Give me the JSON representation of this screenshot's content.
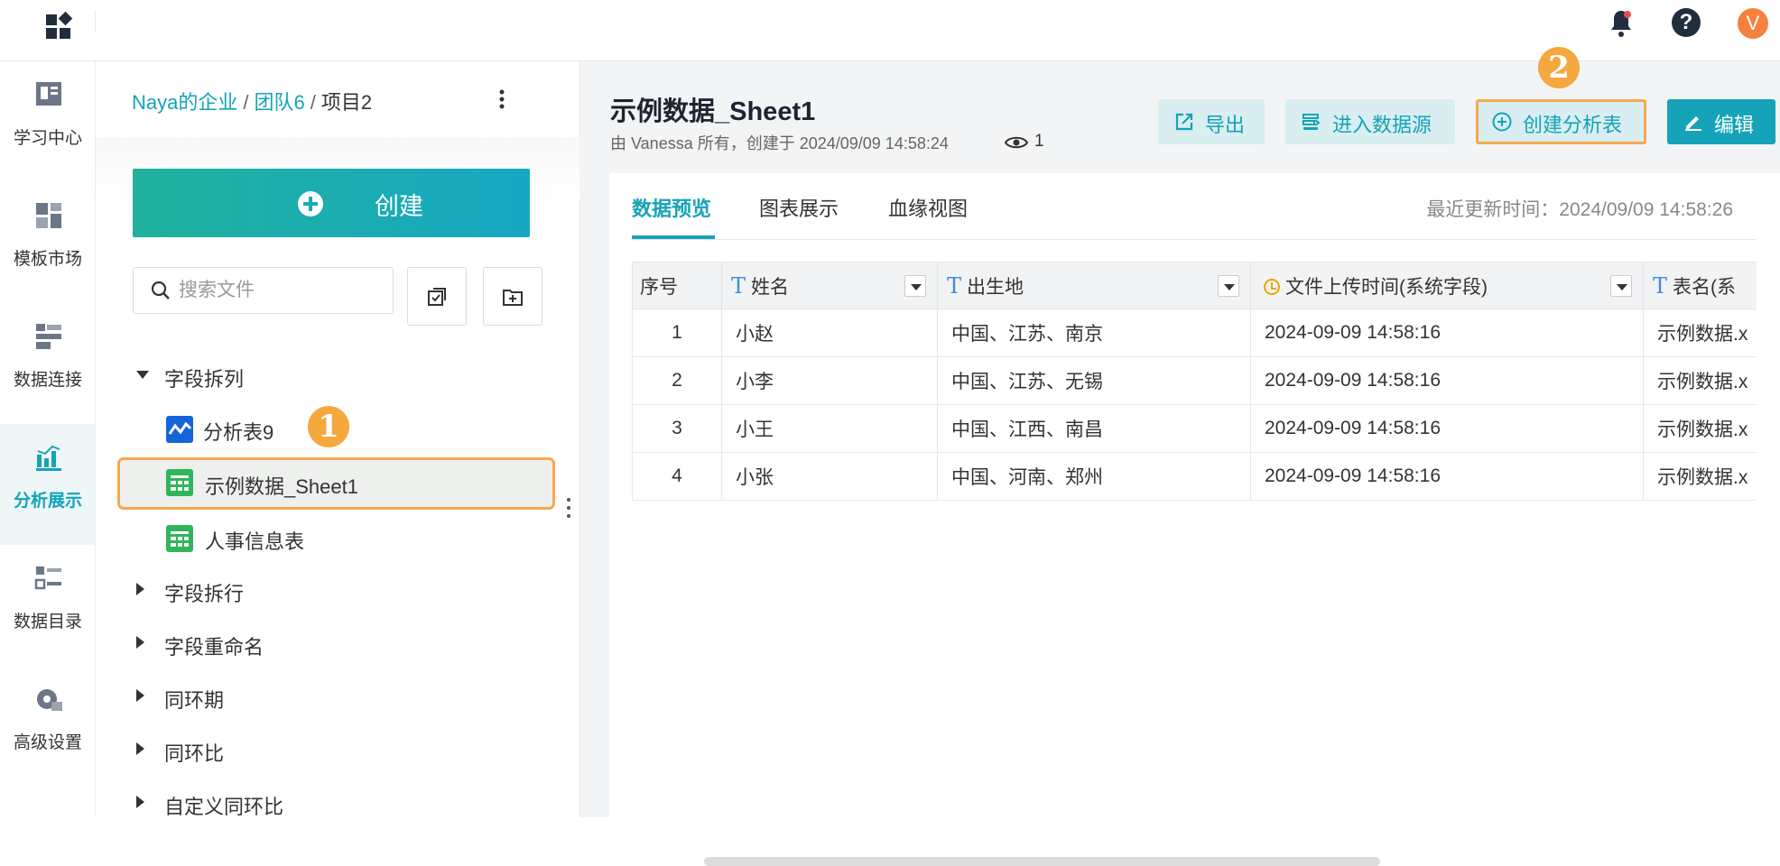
{
  "nav": {
    "items": [
      {
        "label": "学习中心",
        "icon": "learning-center-icon"
      },
      {
        "label": "模板市场",
        "icon": "template-market-icon"
      },
      {
        "label": "数据连接",
        "icon": "data-connection-icon"
      },
      {
        "label": "分析展示",
        "icon": "analysis-display-icon",
        "active": true
      },
      {
        "label": "数据目录",
        "icon": "data-catalog-icon"
      },
      {
        "label": "高级设置",
        "icon": "advanced-settings-icon"
      }
    ]
  },
  "header": {
    "avatar_letter": "V"
  },
  "breadcrumb": {
    "org": "Naya的企业",
    "team": "团队6",
    "project": "项目2",
    "sep": "/"
  },
  "sidebar": {
    "create_label": "创建",
    "search_placeholder": "搜索文件",
    "tree": [
      {
        "label": "字段拆列",
        "expanded": true
      },
      {
        "label": "分析表9",
        "type": "analysis"
      },
      {
        "label": "示例数据_Sheet1",
        "type": "table",
        "selected": true
      },
      {
        "label": "人事信息表",
        "type": "table"
      },
      {
        "label": "字段拆行"
      },
      {
        "label": "字段重命名"
      },
      {
        "label": "同环期"
      },
      {
        "label": "同环比"
      },
      {
        "label": "自定义同环比"
      }
    ],
    "step_badge": "1"
  },
  "dataset": {
    "title": "示例数据_Sheet1",
    "subtitle": "由 Vanessa 所有，创建于 2024/09/09 14:58:24",
    "views": "1"
  },
  "toolbar": {
    "export_label": "导出",
    "datasource_label": "进入数据源",
    "create_analysis_label": "创建分析表",
    "edit_label": "编辑",
    "step_badge": "2"
  },
  "tabs": [
    {
      "label": "数据预览",
      "active": true
    },
    {
      "label": "图表展示"
    },
    {
      "label": "血缘视图"
    }
  ],
  "updated": "最近更新时间：2024/09/09 14:58:26",
  "table": {
    "columns": [
      {
        "label": "序号"
      },
      {
        "label": "姓名",
        "type": "text"
      },
      {
        "label": "出生地",
        "type": "text"
      },
      {
        "label": "文件上传时间(系统字段)",
        "type": "time"
      },
      {
        "label": "表名(系",
        "type": "text"
      }
    ],
    "rows": [
      [
        "1",
        "小赵",
        "中国、江苏、南京",
        "2024-09-09 14:58:16",
        "示例数据.x"
      ],
      [
        "2",
        "小李",
        "中国、江苏、无锡",
        "2024-09-09 14:58:16",
        "示例数据.x"
      ],
      [
        "3",
        "小王",
        "中国、江西、南昌",
        "2024-09-09 14:58:16",
        "示例数据.x"
      ],
      [
        "4",
        "小张",
        "中国、河南、郑州",
        "2024-09-09 14:58:16",
        "示例数据.x"
      ]
    ]
  },
  "colors": {
    "accent": "#14a3b8",
    "highlight": "#f5a94d",
    "badge": "#f5a83e"
  }
}
